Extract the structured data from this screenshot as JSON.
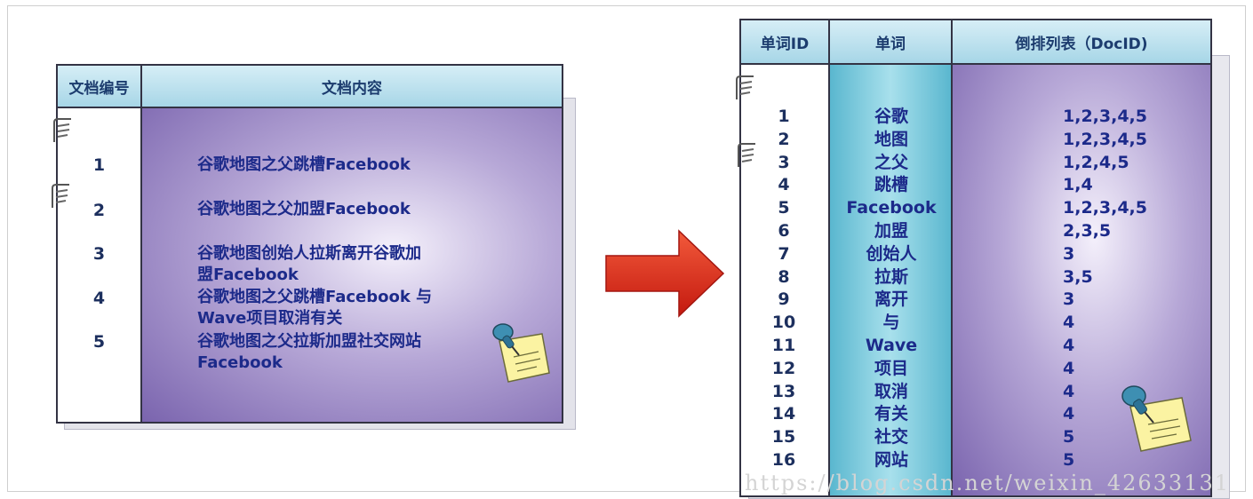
{
  "left_table": {
    "headers": {
      "id": "文档编号",
      "content": "文档内容"
    },
    "rows": [
      {
        "id": "1",
        "lines": [
          "谷歌地图之父跳槽Facebook"
        ]
      },
      {
        "id": "2",
        "lines": [
          "谷歌地图之父加盟Facebook"
        ]
      },
      {
        "id": "3",
        "lines": [
          "谷歌地图创始人拉斯离开谷歌加",
          "盟Facebook"
        ]
      },
      {
        "id": "4",
        "lines": [
          "谷歌地图之父跳槽Facebook 与",
          "Wave项目取消有关"
        ]
      },
      {
        "id": "5",
        "lines": [
          "谷歌地图之父拉斯加盟社交网站",
          "Facebook"
        ]
      }
    ]
  },
  "right_table": {
    "headers": {
      "id": "单词ID",
      "word": "单词",
      "list": "倒排列表（DocID)"
    },
    "rows": [
      {
        "id": "1",
        "word": "谷歌",
        "list": "1,2,3,4,5"
      },
      {
        "id": "2",
        "word": "地图",
        "list": "1,2,3,4,5"
      },
      {
        "id": "3",
        "word": "之父",
        "list": "1,2,4,5"
      },
      {
        "id": "4",
        "word": "跳槽",
        "list": "1,4"
      },
      {
        "id": "5",
        "word": "Facebook",
        "list": "1,2,3,4,5"
      },
      {
        "id": "6",
        "word": "加盟",
        "list": "2,3,5"
      },
      {
        "id": "7",
        "word": "创始人",
        "list": "3"
      },
      {
        "id": "8",
        "word": "拉斯",
        "list": "3,5"
      },
      {
        "id": "9",
        "word": "离开",
        "list": "3"
      },
      {
        "id": "10",
        "word": "与",
        "list": "4"
      },
      {
        "id": "11",
        "word": "Wave",
        "list": "4"
      },
      {
        "id": "12",
        "word": "项目",
        "list": "4"
      },
      {
        "id": "13",
        "word": "取消",
        "list": "4"
      },
      {
        "id": "14",
        "word": "有关",
        "list": "4"
      },
      {
        "id": "15",
        "word": "社交",
        "list": "5"
      },
      {
        "id": "16",
        "word": "网站",
        "list": "5"
      }
    ]
  },
  "watermark": "https://blog.csdn.net/weixin_42633131",
  "colors": {
    "header_fill": "#a7d6e7",
    "purple_fill": "#7a64ae",
    "word_column_fill": "#5ab7cf",
    "arrow_fill": "#e02a1c",
    "text_blue": "#1c2a8a"
  },
  "icons": [
    "paper-clip-icon",
    "pushpin-note-icon",
    "right-arrow-icon"
  ]
}
